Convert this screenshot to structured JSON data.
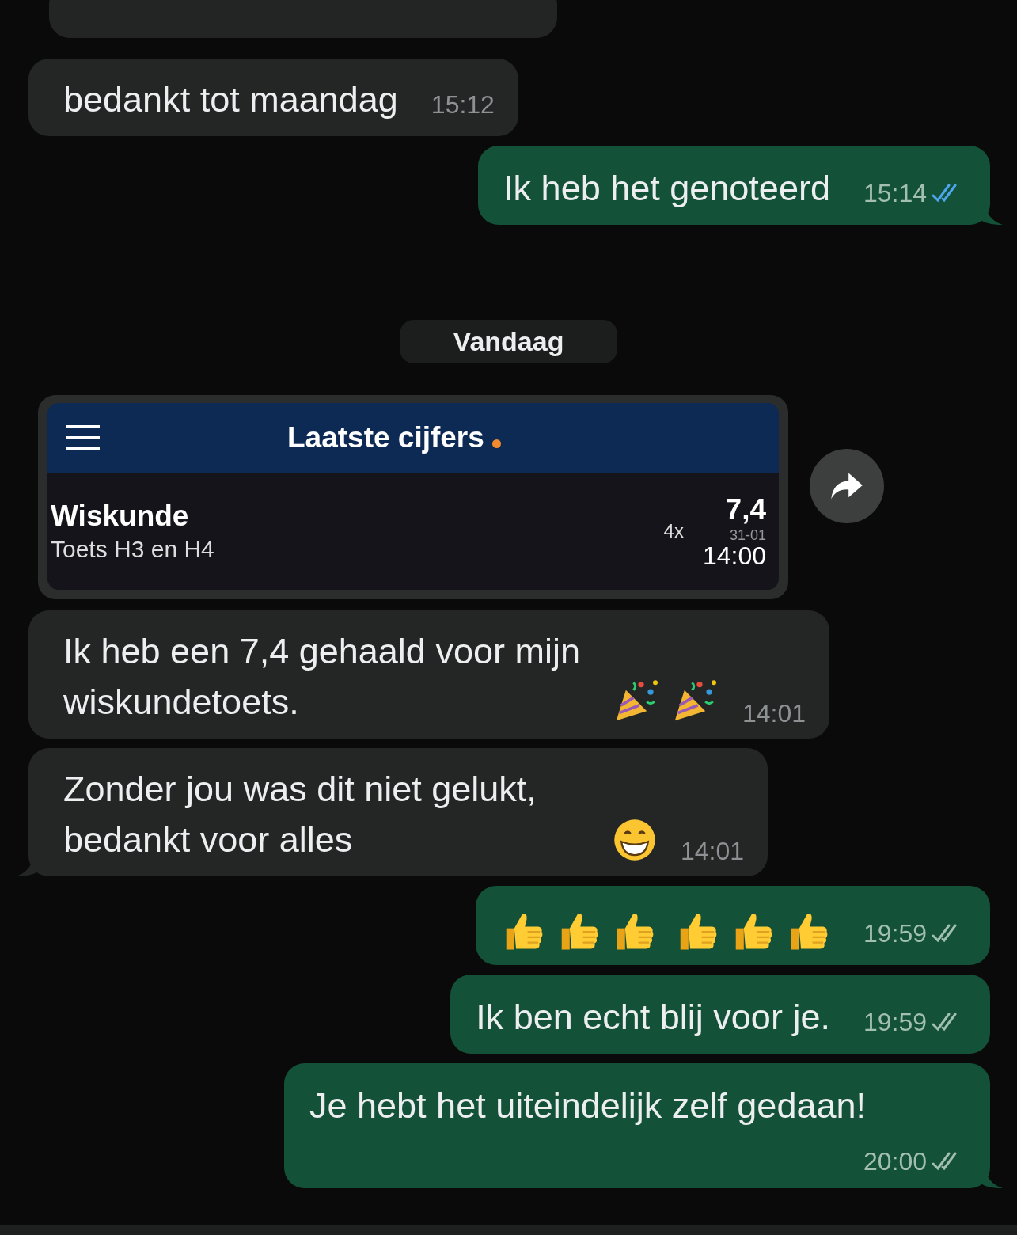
{
  "messages": [
    {
      "kind": "clipped",
      "outgoing": false
    },
    {
      "kind": "text",
      "outgoing": false,
      "text": "bedankt tot maandag",
      "time": "15:12",
      "tail": false
    },
    {
      "kind": "text",
      "outgoing": true,
      "text": "Ik heb het genoteerd",
      "time": "15:14",
      "read": true,
      "tail": true
    },
    {
      "kind": "date",
      "text": "Vandaag"
    },
    {
      "kind": "image",
      "outgoing": false,
      "time": "14:00",
      "card": {
        "title": "Laatste cijfers",
        "subject": "Wiskunde",
        "description": "Toets H3 en H4",
        "weight": "4x",
        "grade": "7,4",
        "date": "31-01"
      }
    },
    {
      "kind": "text",
      "outgoing": false,
      "text": "Ik heb een 7,4 gehaald voor mijn wiskundetoets.",
      "emojis": [
        {
          "kind": "party-popper"
        },
        {
          "kind": "party-popper"
        }
      ],
      "time": "14:01",
      "tail": false
    },
    {
      "kind": "text",
      "outgoing": false,
      "text": "Zonder jou was dit niet gelukt, bedankt voor alles",
      "emojis": [
        {
          "kind": "grin"
        }
      ],
      "time": "14:01",
      "tail": true
    },
    {
      "kind": "text",
      "outgoing": true,
      "emojis": [
        {
          "kind": "thumbs-up"
        },
        {
          "kind": "thumbs-up"
        },
        {
          "kind": "thumbs-up"
        },
        {
          "kind": "thumbs-up"
        },
        {
          "kind": "thumbs-up"
        },
        {
          "kind": "thumbs-up"
        }
      ],
      "time": "19:59",
      "read": false,
      "tail": false
    },
    {
      "kind": "text",
      "outgoing": true,
      "text": "Ik ben echt blij voor je.",
      "time": "19:59",
      "read": false,
      "tail": false
    },
    {
      "kind": "text",
      "outgoing": true,
      "text": "Je hebt het uiteindelijk zelf gedaan!",
      "time": "20:00",
      "read": false,
      "tail": true
    }
  ]
}
